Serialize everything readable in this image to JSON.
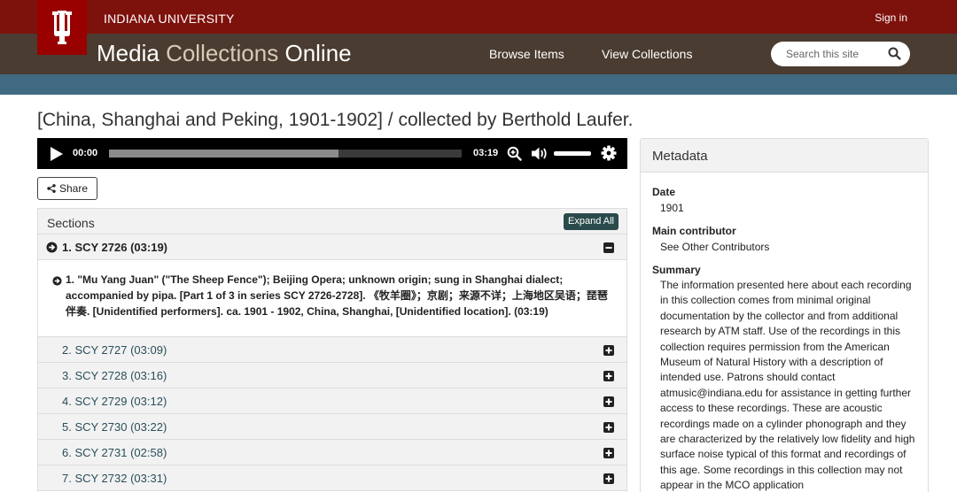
{
  "header": {
    "university": "INDIANA UNIVERSITY",
    "signin": "Sign in",
    "site_title_part1": "Media",
    "site_title_part2": "Collections",
    "site_title_part3": "Online",
    "nav": [
      "Browse Items",
      "View Collections"
    ],
    "search_placeholder": "Search this site"
  },
  "page_title": "[China, Shanghai and Peking, 1901-1902] / collected by Berthold Laufer.",
  "player": {
    "current_time": "00:00",
    "duration": "03:19",
    "buffered_fraction": 0.65
  },
  "share_label": "Share",
  "sections": {
    "title": "Sections",
    "expand_all": "Expand All",
    "open_section": "1. SCY 2726 (03:19)",
    "open_item": "1. \"Mu Yang Juan\" (\"The Sheep Fence\"); Beijing Opera; unknown origin; sung in Shanghai dialect; accompanied by pipa. [Part 1 of 3 in series SCY 2726-2728]. 《牧羊圈》；京剧；来源不详；上海地区吴语；琵琶伴奏. [Unidentified performers]. ca. 1901 - 1902, China, Shanghai, [Unidentified location]. (03:19)",
    "rows": [
      "2. SCY 2727 (03:09)",
      "3. SCY 2728 (03:16)",
      "4. SCY 2729 (03:12)",
      "5. SCY 2730 (03:22)",
      "6. SCY 2731 (02:58)",
      "7. SCY 2732 (03:31)"
    ]
  },
  "metadata": {
    "title": "Metadata",
    "date_label": "Date",
    "date_value": "1901",
    "contributor_label": "Main contributor",
    "contributor_value": "See Other Contributors",
    "summary_label": "Summary",
    "summary_text": "The information presented here about each recording in this collection comes from minimal original documentation by the collector and from additional research by ATM staff. Use of the recordings in this collection requires permission from the American Museum of Natural History with a description of intended use. Patrons should contact atmusic@indiana.edu for assistance in getting further access to these recordings. These are acoustic recordings made on a cylinder phonograph and they are characterized by the relatively low fidelity and high surface noise typical of this format and recordings of this age. Some recordings in this collection may not appear in the MCO application"
  },
  "colors": {
    "crimson": "#7d110c",
    "brown": "#4a3c31",
    "blue": "#3f6a82",
    "teal_button": "#2a4a4b"
  }
}
